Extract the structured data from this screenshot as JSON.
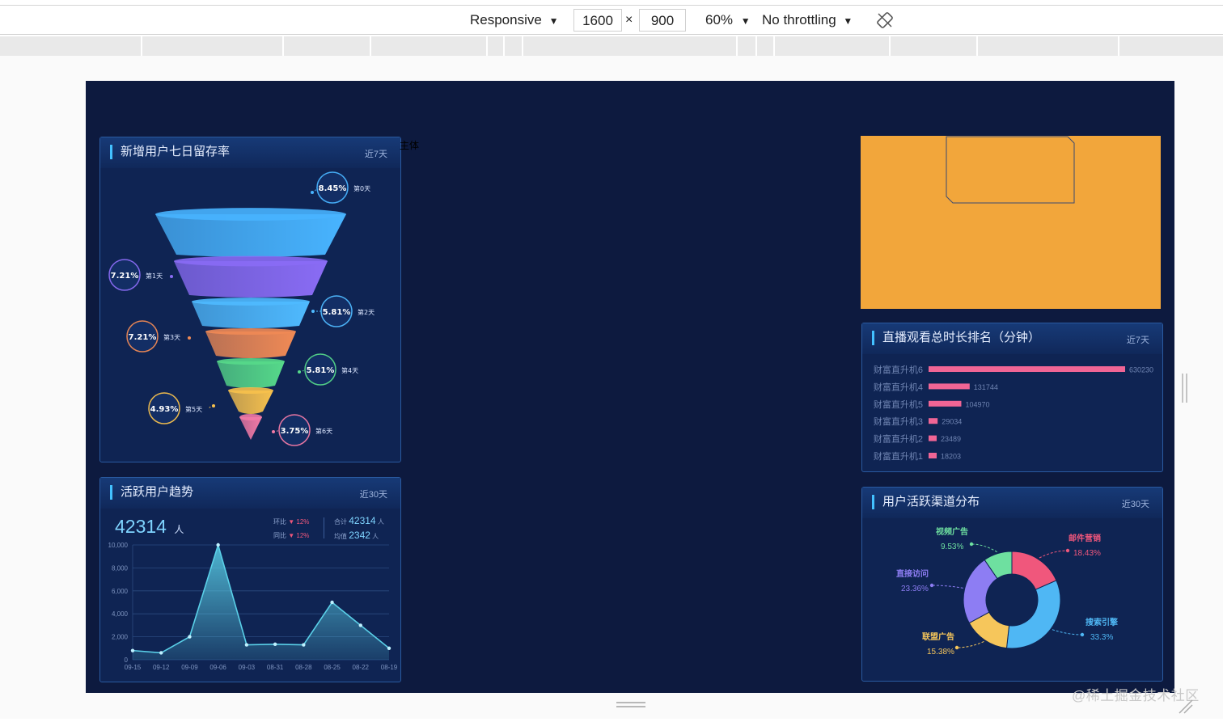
{
  "devtools": {
    "device": "Responsive",
    "width": "1600",
    "times": "×",
    "height": "900",
    "zoom": "60%",
    "throttling": "No throttling",
    "rotate_icon": "rotate-icon"
  },
  "stray_label": "主体",
  "retention_panel": {
    "title": "新增用户七日留存率",
    "period": "近7天",
    "stages": [
      {
        "day": "第0天",
        "rate": "8.45%",
        "color": "#48b4ff"
      },
      {
        "day": "第1天",
        "rate": "7.21%",
        "color": "#8a6cf5"
      },
      {
        "day": "第2天",
        "rate": "5.81%",
        "color": "#4fbaff"
      },
      {
        "day": "第3天",
        "rate": "7.21%",
        "color": "#f08a55"
      },
      {
        "day": "第4天",
        "rate": "5.81%",
        "color": "#56d98a"
      },
      {
        "day": "第5天",
        "rate": "4.93%",
        "color": "#f7c14d"
      },
      {
        "day": "第6天",
        "rate": "3.75%",
        "color": "#f27aa6"
      }
    ]
  },
  "trend_panel": {
    "title": "活跃用户趋势",
    "period": "近30天",
    "total_value": "42314",
    "total_unit": "人",
    "mom_label": "环比",
    "mom_value": "12%",
    "yoy_label": "同比",
    "yoy_value": "12%",
    "sum_label": "合计",
    "sum_value": "42314",
    "sum_unit": "人",
    "avg_label": "均值",
    "avg_value": "2342",
    "avg_unit": "人"
  },
  "ranking_panel": {
    "title": "直播观看总时长排名（分钟）",
    "period": "近7天"
  },
  "channel_panel": {
    "title": "用户活跃渠道分布",
    "period": "近30天"
  },
  "chart_data": [
    {
      "type": "area",
      "x": [
        "09-15",
        "09-12",
        "09-09",
        "09-06",
        "09-03",
        "08-31",
        "08-28",
        "08-25",
        "08-22",
        "08-19"
      ],
      "series": [
        {
          "values": [
            800,
            600,
            2000,
            10000,
            1300,
            1350,
            1300,
            5000,
            3000,
            1000
          ]
        }
      ],
      "y_ticks": [
        "0",
        "2,000",
        "4,000",
        "6,000",
        "8,000",
        "10,000"
      ],
      "ylim": [
        0,
        10000
      ],
      "grid": true,
      "color": "#5ad0e8"
    },
    {
      "type": "bar",
      "orientation": "horizontal",
      "categories": [
        "财富直升机6",
        "财富直升机4",
        "财富直升机5",
        "财富直升机3",
        "财富直升机2",
        "财富直升机1"
      ],
      "values": [
        630230,
        131744,
        104970,
        29034,
        23489,
        18203
      ],
      "value_labels": [
        "630230",
        "131744",
        "104970",
        "29034",
        "23489",
        "18203"
      ],
      "color": "#f06595"
    },
    {
      "type": "pie",
      "donut": true,
      "slices": [
        {
          "label": "邮件营销",
          "value": 18.43,
          "value_label": "18.43%",
          "color": "#f0577c"
        },
        {
          "label": "搜索引擎",
          "value": 33.3,
          "value_label": "33.3%",
          "color": "#4fb7f4"
        },
        {
          "label": "联盟广告",
          "value": 15.38,
          "value_label": "15.38%",
          "color": "#f6c65b"
        },
        {
          "label": "直接访问",
          "value": 23.36,
          "value_label": "23.36%",
          "color": "#8d7df3"
        },
        {
          "label": "视频广告",
          "value": 9.53,
          "value_label": "9.53%",
          "color": "#6ee0a0"
        }
      ]
    }
  ],
  "colors": {
    "page_bg": "#0d1a3f",
    "panel_bg": "#0f2453",
    "panel_border": "#2a5aa0",
    "accent": "#43c1ff",
    "placeholder_orange": "#f2a63b"
  },
  "watermark": "@稀土掘金技术社区"
}
